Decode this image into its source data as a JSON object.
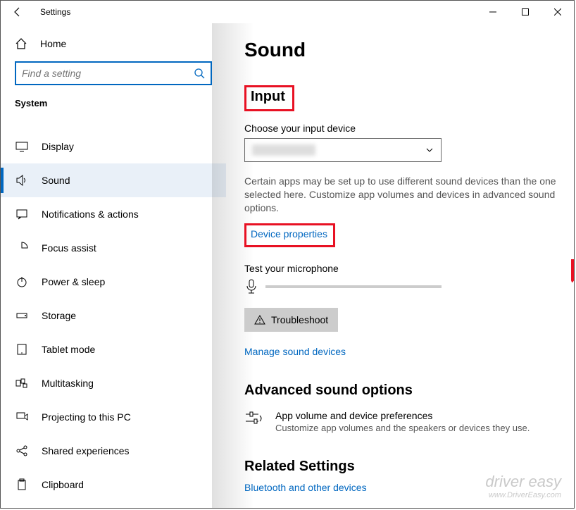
{
  "window": {
    "title": "Settings"
  },
  "sidebar": {
    "home": "Home",
    "search_placeholder": "Find a setting",
    "section": "System",
    "items": [
      {
        "label": "Display",
        "icon": "display"
      },
      {
        "label": "Sound",
        "icon": "sound"
      },
      {
        "label": "Notifications & actions",
        "icon": "notifications"
      },
      {
        "label": "Focus assist",
        "icon": "focus"
      },
      {
        "label": "Power & sleep",
        "icon": "power"
      },
      {
        "label": "Storage",
        "icon": "storage"
      },
      {
        "label": "Tablet mode",
        "icon": "tablet"
      },
      {
        "label": "Multitasking",
        "icon": "multitasking"
      },
      {
        "label": "Projecting to this PC",
        "icon": "projecting"
      },
      {
        "label": "Shared experiences",
        "icon": "shared"
      },
      {
        "label": "Clipboard",
        "icon": "clipboard"
      }
    ]
  },
  "main": {
    "title": "Sound",
    "input_heading": "Input",
    "choose_label": "Choose your input device",
    "desc": "Certain apps may be set up to use different sound devices than the one selected here. Customize app volumes and devices in advanced sound options.",
    "device_props": "Device properties",
    "test_label": "Test your microphone",
    "troubleshoot": "Troubleshoot",
    "manage": "Manage sound devices",
    "adv_title": "Advanced sound options",
    "adv_item_title": "App volume and device preferences",
    "adv_item_desc": "Customize app volumes and the speakers or devices they use.",
    "related_title": "Related Settings",
    "related_link": "Bluetooth and other devices"
  },
  "watermark": {
    "brand": "driver easy",
    "url": "www.DriverEasy.com"
  }
}
